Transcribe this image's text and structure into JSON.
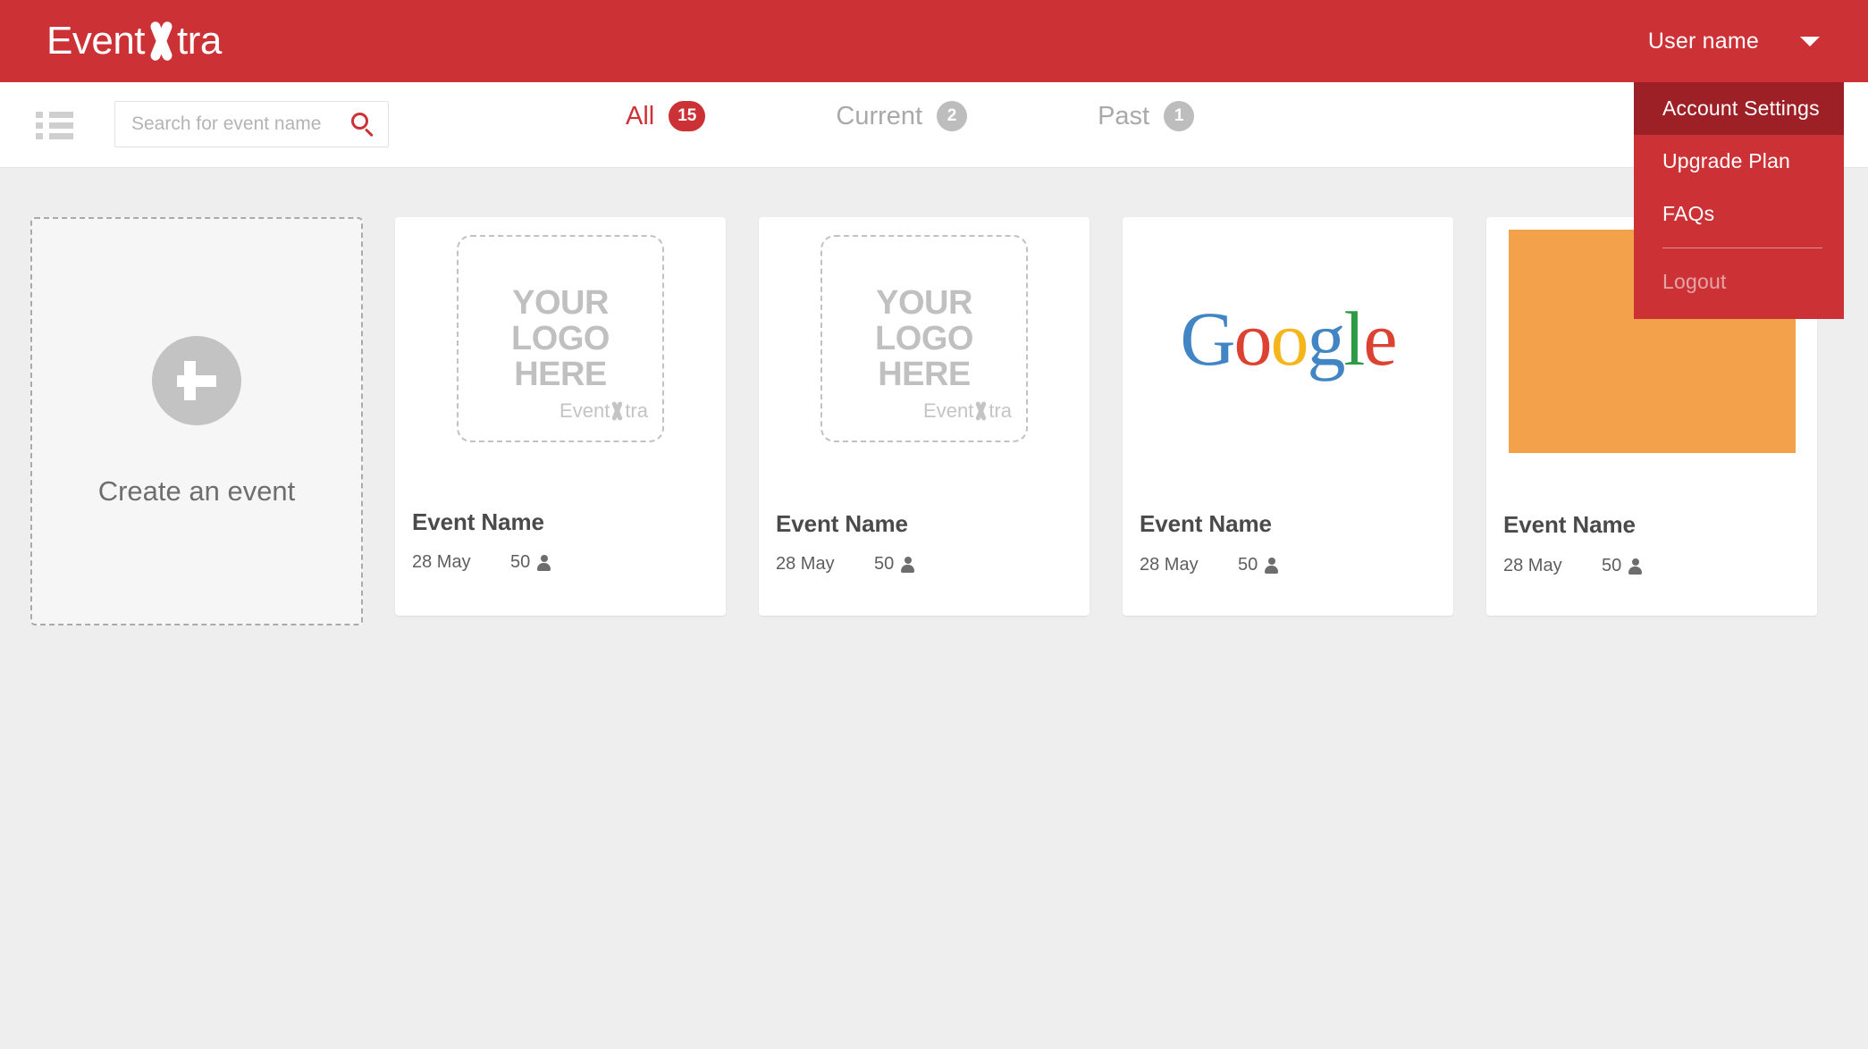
{
  "brand": {
    "name_part1": "Event",
    "name_part2": "tra",
    "accent": "#cc3136"
  },
  "header": {
    "user_name": "User name",
    "caret_icon": "chevron-down-icon"
  },
  "user_menu": {
    "items": [
      {
        "label": "Account Settings",
        "state": "active"
      },
      {
        "label": "Upgrade Plan",
        "state": "normal"
      },
      {
        "label": "FAQs",
        "state": "normal"
      },
      {
        "label": "Logout",
        "state": "disabled"
      }
    ]
  },
  "toolbar": {
    "list_view_icon": "list-view-icon",
    "search": {
      "value": "",
      "placeholder": "Search for event name",
      "icon": "search-icon"
    },
    "tabs": [
      {
        "label": "All",
        "count": "15",
        "active": true
      },
      {
        "label": "Current",
        "count": "2",
        "active": false
      },
      {
        "label": "Past",
        "count": "1",
        "active": false
      }
    ]
  },
  "content": {
    "create_card": {
      "label": "Create an event",
      "icon": "plus-icon"
    },
    "logo_placeholder": {
      "line1": "YOUR",
      "line2": "LOGO",
      "line3": "HERE",
      "watermark_part1": "Event",
      "watermark_part2": "tra"
    },
    "google_logo": {
      "l1": "G",
      "l2": "o",
      "l3": "o",
      "l4": "g",
      "l5": "l",
      "l6": "e"
    },
    "cards": [
      {
        "name": "Event Name",
        "date": "28 May",
        "attendees": "50",
        "media": "logo-placeholder"
      },
      {
        "name": "Event Name",
        "date": "28 May",
        "attendees": "50",
        "media": "logo-placeholder"
      },
      {
        "name": "Event Name",
        "date": "28 May",
        "attendees": "50",
        "media": "google-logo"
      },
      {
        "name": "Event Name",
        "date": "28 May",
        "attendees": "50",
        "media": "orange-block",
        "media_color": "#f4a14c"
      }
    ]
  }
}
